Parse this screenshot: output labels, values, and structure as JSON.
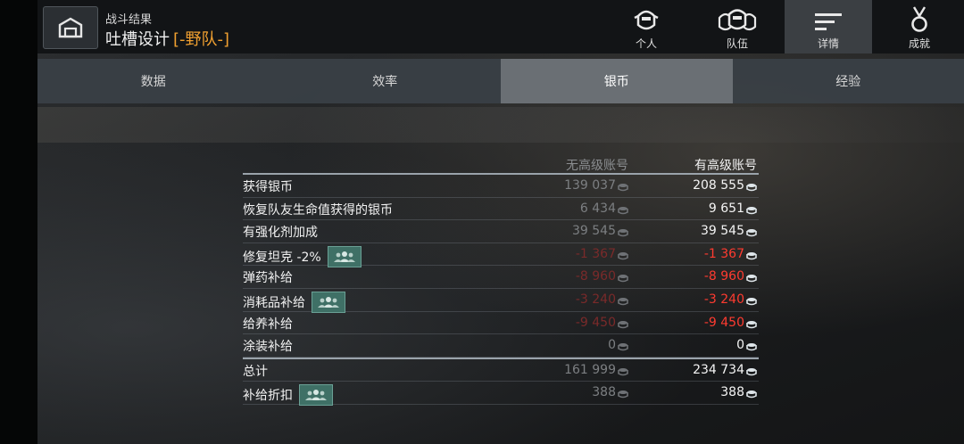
{
  "header": {
    "subtitle": "战斗结果",
    "title": "吐槽设计",
    "tag": "[-野队-]"
  },
  "nav": {
    "items": [
      {
        "label": "个人",
        "icon": "personal-helmet-icon",
        "active": false
      },
      {
        "label": "队伍",
        "icon": "team-helmets-icon",
        "active": false
      },
      {
        "label": "详情",
        "icon": "details-list-icon",
        "active": true
      },
      {
        "label": "成就",
        "icon": "medal-icon",
        "active": false
      }
    ]
  },
  "tabs": [
    {
      "label": "数据",
      "active": false
    },
    {
      "label": "效率",
      "active": false
    },
    {
      "label": "银币",
      "active": true
    },
    {
      "label": "经验",
      "active": false
    }
  ],
  "table": {
    "col_no_premium": "无高级账号",
    "col_premium": "有高级账号",
    "rows": [
      {
        "label": "获得银币",
        "no_premium": "139 037",
        "premium": "208 555",
        "negative": false,
        "team_badge": false
      },
      {
        "label": "恢复队友生命值获得的银币",
        "no_premium": "6 434",
        "premium": "9 651",
        "negative": false,
        "team_badge": false
      },
      {
        "label": "有强化剂加成",
        "no_premium": "39 545",
        "premium": "39 545",
        "negative": false,
        "team_badge": false
      },
      {
        "label": "修复坦克 -2%",
        "no_premium": "-1 367",
        "premium": "-1 367",
        "negative": true,
        "team_badge": true
      },
      {
        "label": "弹药补给",
        "no_premium": "-8 960",
        "premium": "-8 960",
        "negative": true,
        "team_badge": false
      },
      {
        "label": "消耗品补给",
        "no_premium": "-3 240",
        "premium": "-3 240",
        "negative": true,
        "team_badge": true
      },
      {
        "label": "给养补给",
        "no_premium": "-9 450",
        "premium": "-9 450",
        "negative": true,
        "team_badge": false
      },
      {
        "label": "涂装补给",
        "no_premium": "0",
        "premium": "0",
        "negative": false,
        "team_badge": false
      }
    ],
    "total": {
      "label": "总计",
      "no_premium": "161 999",
      "premium": "234 734"
    },
    "discount": {
      "label": "补给折扣",
      "no_premium": "388",
      "premium": "388"
    }
  },
  "colors": {
    "accent_tag": "#f0a030",
    "negative": "#ff3b30",
    "badge": "#3f7066"
  }
}
